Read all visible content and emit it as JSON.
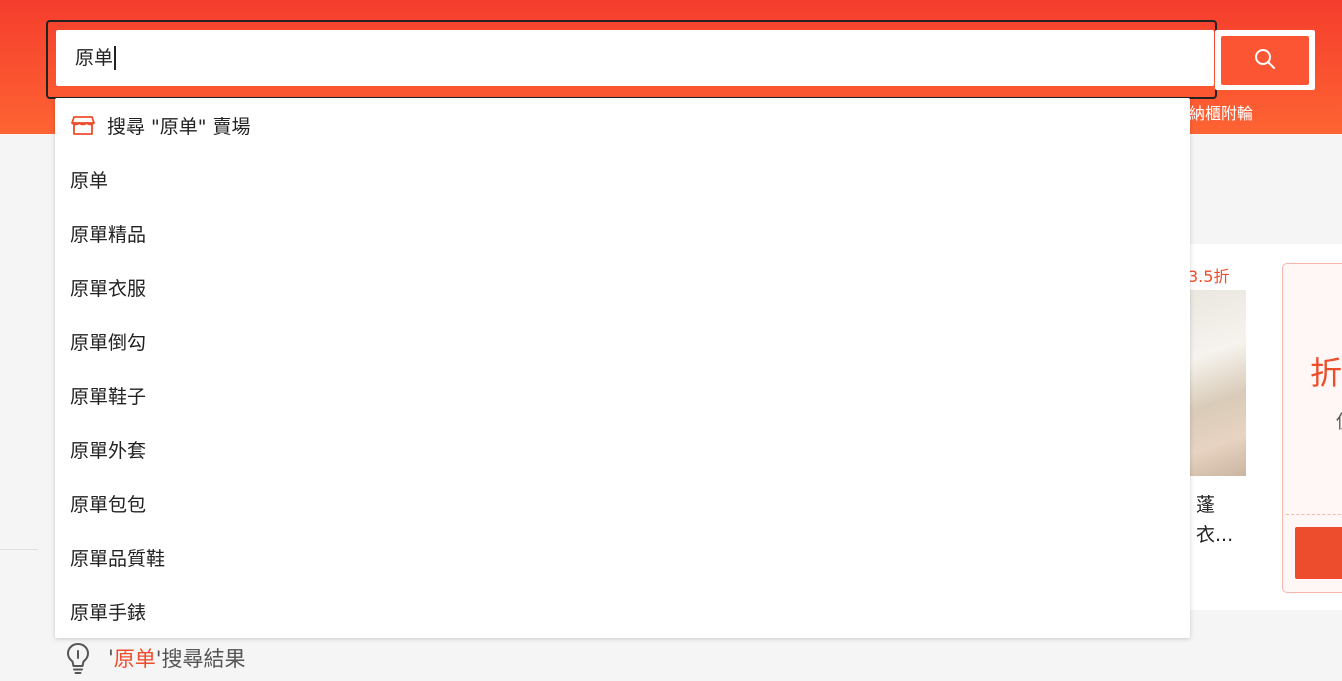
{
  "header": {
    "search": {
      "value": "原单"
    },
    "search_button_icon": "search-icon",
    "hint_text": "納櫃附輪"
  },
  "dropdown": {
    "shop_suggestion": {
      "icon": "shop-icon",
      "label": "搜尋 \"原单\" 賣場"
    },
    "suggestions": [
      "原单",
      "原單精品",
      "原單衣服",
      "原單倒勾",
      "原單鞋子",
      "原單外套",
      "原單包包",
      "原單品質鞋",
      "原單手錶"
    ]
  },
  "background": {
    "discount_tag": "3.5折",
    "product_title_line1": "蓬",
    "product_title_line2": "衣...",
    "coupon_big": "折",
    "coupon_small": "使"
  },
  "results": {
    "icon": "lightbulb-icon",
    "prefix": "'",
    "keyword": "原单",
    "suffix": "'搜尋結果"
  },
  "colors": {
    "brand": "#ee4d2d",
    "header_top": "#f53d2d",
    "header_bottom": "#fe6433"
  }
}
